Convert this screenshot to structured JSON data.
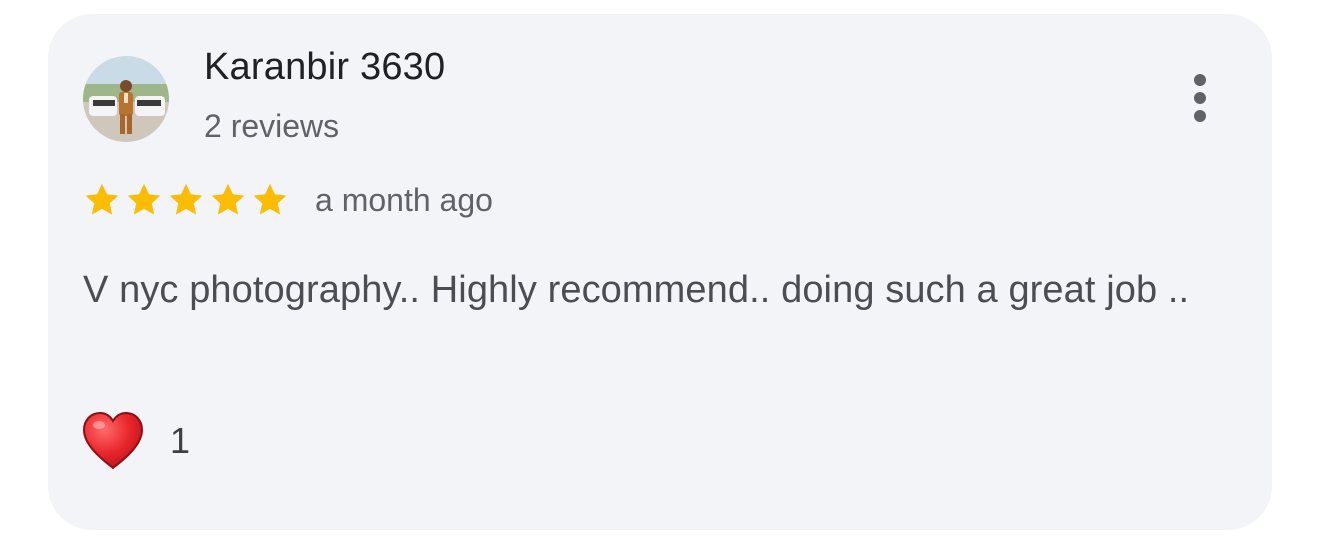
{
  "review": {
    "author_name": "Karanbir 3630",
    "author_reviews": "2 reviews",
    "rating_stars": 5,
    "rating_max": 5,
    "date": "a month ago",
    "text": "V nyc photography.. Highly recommend.. doing such a great job ..",
    "reaction_icon": "red-heart-icon",
    "reaction_count": "1",
    "more_icon": "more-vertical-icon",
    "star_color": "#fbbc04",
    "card_color": "#f3f4f7"
  }
}
